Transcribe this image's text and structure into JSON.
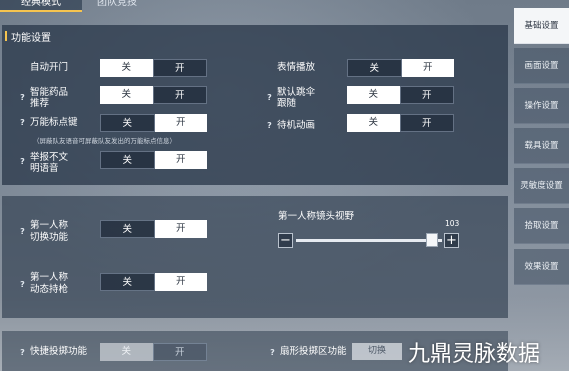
{
  "mode_tabs": [
    {
      "label": "经典模式"
    },
    {
      "label": "团队竞技"
    }
  ],
  "section_title": "功能设置",
  "settings": {
    "auto_door": {
      "label": "自动开门",
      "on_label": "关",
      "off_label": "开",
      "selected": "关"
    },
    "smart_med": {
      "label": "智能药品推荐",
      "line1": "智能药品",
      "line2": "推荐",
      "on_label": "关",
      "off_label": "开",
      "selected": "关"
    },
    "universal_mark": {
      "label": "万能标点键",
      "on_label": "关",
      "off_label": "开",
      "selected": "开"
    },
    "mark_note": "（屏蔽队友语音可屏蔽队友发出的万能标点信息）",
    "report_voice": {
      "label": "举报不文明语音",
      "line1": "举报不文",
      "line2": "明语音",
      "on_label": "关",
      "off_label": "开",
      "selected": "开"
    },
    "emote_play": {
      "label": "表情播放",
      "on_label": "关",
      "off_label": "开",
      "selected": "开"
    },
    "default_follow": {
      "label": "默认跳伞跟随",
      "line1": "默认跳伞",
      "line2": "跟随",
      "on_label": "关",
      "off_label": "开",
      "selected": "关"
    },
    "idle_anim": {
      "label": "待机动画",
      "on_label": "关",
      "off_label": "开",
      "selected": "关"
    },
    "fp_switch": {
      "label": "第一人称切换功能",
      "line1": "第一人称",
      "line2": "切换功能",
      "on_label": "关",
      "off_label": "开",
      "selected": "开"
    },
    "fp_dynamic": {
      "label": "第一人称动态持枪",
      "line1": "第一人称",
      "line2": "动态持枪",
      "on_label": "关",
      "off_label": "开",
      "selected": "开"
    },
    "quick_throw": {
      "label": "快捷投掷功能",
      "on_label": "关",
      "off_label": "开",
      "selected": "关"
    },
    "fan_throw": {
      "label": "扇形投掷区功能",
      "value": "切换"
    }
  },
  "fov_slider": {
    "label": "第一人称镜头视野",
    "value": "103",
    "fraction": 0.93,
    "minus": "−",
    "plus": "+"
  },
  "sidebar": {
    "items": [
      {
        "label": "基础设置",
        "active": true
      },
      {
        "label": "画面设置"
      },
      {
        "label": "操作设置"
      },
      {
        "label": "载具设置"
      },
      {
        "label": "灵敏度设置"
      },
      {
        "label": "拾取设置"
      },
      {
        "label": "效果设置"
      }
    ]
  },
  "help_icon_glyph": "?",
  "watermark": "九鼎灵脉数据"
}
